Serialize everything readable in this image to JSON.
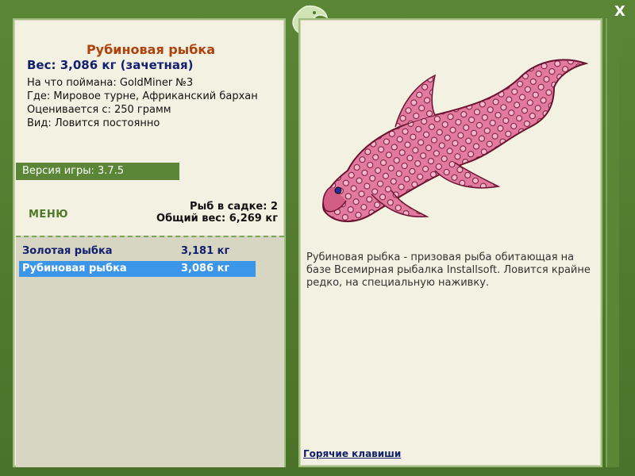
{
  "window": {
    "close_label": "X"
  },
  "fish": {
    "title": "Рубиновая рыбка",
    "weight_line": "Вес: 3,086 кг (зачетная)",
    "caught_on": "На что поймана: GoldMiner №3",
    "where": "Где: Мировое турне, Африканский бархан",
    "valued_from": "Оценивается с: 250 грамм",
    "kind": "Вид: Ловится постоянно",
    "description": "Рубиновая рыбка - призовая рыба обитающая на базе Всемирная рыбалка Installsoft. Ловится крайне редко, на специальную наживку."
  },
  "version": {
    "label": "Версия игры: 3.7.5"
  },
  "menu": {
    "label": "МЕНЮ"
  },
  "cage": {
    "count_line": "Рыб в садке: 2",
    "total_line": "Общий вес: 6,269 кг"
  },
  "catch_list": [
    {
      "name": "Золотая рыбка",
      "weight": "3,181 кг",
      "selected": false
    },
    {
      "name": "Рубиновая рыбка",
      "weight": "3,086 кг",
      "selected": true
    }
  ],
  "links": {
    "hotkeys": "Горячие клавиши"
  },
  "colors": {
    "frame": "#5b8636",
    "panel": "#f3f1e2",
    "title": "#b0410d",
    "selected_row": "#3b96ea",
    "fish": "#d45d86"
  }
}
